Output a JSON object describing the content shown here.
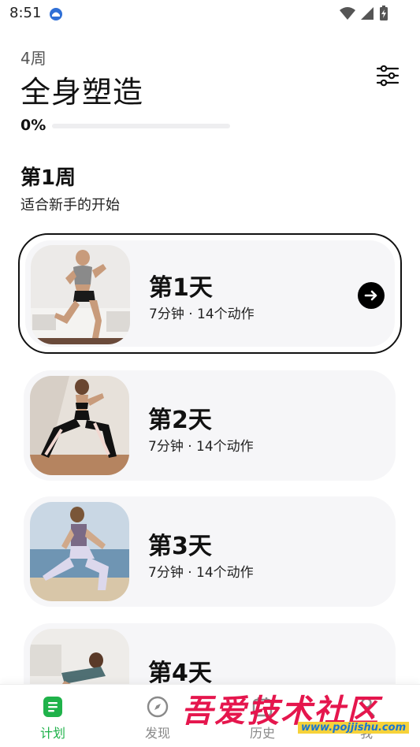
{
  "status_bar": {
    "time": "8:51"
  },
  "header": {
    "weeks_label": "4周",
    "title": "全身塑造",
    "progress": {
      "label": "0%",
      "value": 0
    }
  },
  "week": {
    "title": "第1周",
    "subtitle": "适合新手的开始"
  },
  "days": [
    {
      "title": "第1天",
      "meta": "7分钟 · 14个动作",
      "active": true
    },
    {
      "title": "第2天",
      "meta": "7分钟 · 14个动作",
      "active": false
    },
    {
      "title": "第3天",
      "meta": "7分钟 · 14个动作",
      "active": false
    },
    {
      "title": "第4天",
      "meta": "",
      "active": false
    }
  ],
  "bottom_nav": [
    {
      "label": "计划",
      "icon": "plan-icon",
      "active": true
    },
    {
      "label": "发现",
      "icon": "compass-icon",
      "active": false
    },
    {
      "label": "历史",
      "icon": "history-icon",
      "active": false
    },
    {
      "label": "我",
      "icon": "profile-icon",
      "active": false
    }
  ],
  "colors": {
    "accent": "#1fb24a",
    "card_bg": "#f6f6f8",
    "text": "#111111"
  },
  "watermark": {
    "main": "吾爱技术社区",
    "url": "www.pojjishu.com"
  }
}
